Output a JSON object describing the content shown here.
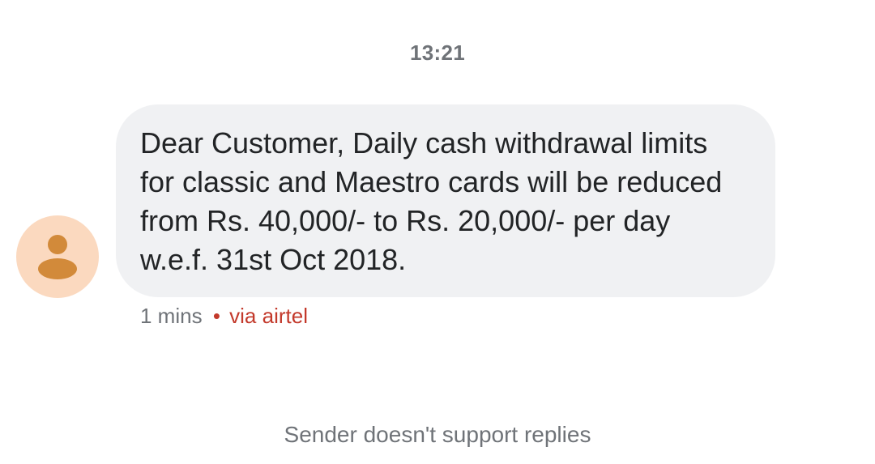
{
  "thread": {
    "timestamp": "13:21"
  },
  "message": {
    "text": "Dear Customer, Daily cash withdrawal limits for classic and Maestro cards will be reduced from Rs. 40,000/- to Rs. 20,000/- per day w.e.f. 31st Oct 2018.",
    "meta_time": "1 mins",
    "meta_separator": "•",
    "meta_via": "via airtel",
    "avatar_icon": "person-icon"
  },
  "footer": {
    "note": "Sender doesn't support replies"
  },
  "colors": {
    "bubble": "#f0f1f3",
    "avatar_bg": "#fbd9bf",
    "avatar_fg": "#d28a3a",
    "via_accent": "#c3392b",
    "muted_text": "#6f7378"
  }
}
